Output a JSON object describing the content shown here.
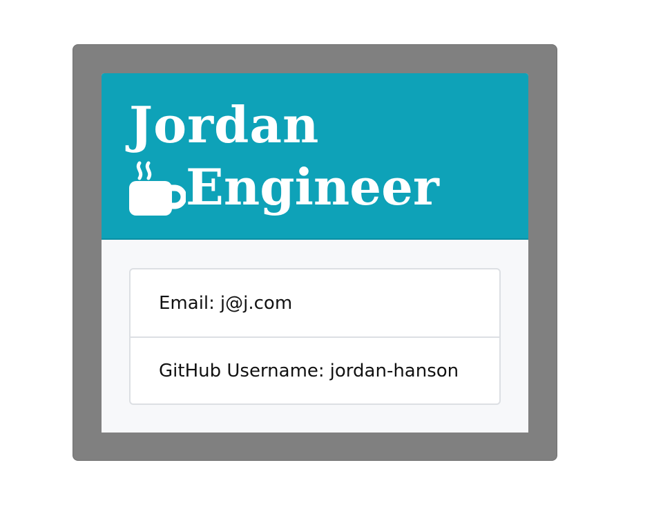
{
  "employee": {
    "name": "Jordan",
    "role": "Engineer",
    "role_icon": "coffee-mug-icon"
  },
  "details": [
    {
      "label": "Email:",
      "value": "j@j.com"
    },
    {
      "label": "GitHub Username:",
      "value": "jordan-hanson"
    }
  ],
  "colors": {
    "frame": "#808080",
    "header": "#0ea2b8",
    "card_body": "#f7f8fa",
    "list_border": "#dcdfe3"
  }
}
